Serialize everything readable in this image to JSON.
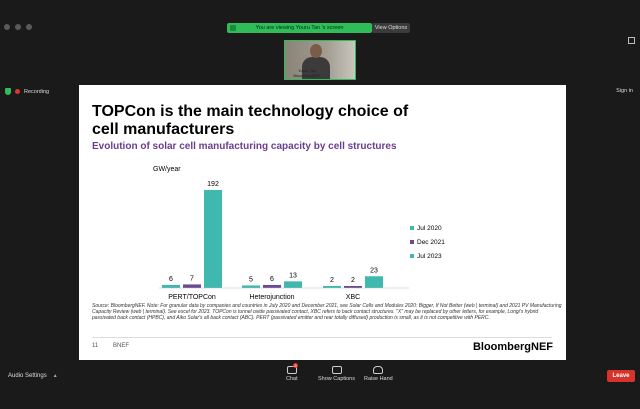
{
  "zoom": {
    "share_banner": "You are viewing Youru Tan  's screen",
    "view_options": "View Options",
    "recording": "Recording",
    "signin": "Sign in",
    "participant_name_line1": "Youru Tan",
    "participant_name_line2": "BloombergNEF"
  },
  "slide": {
    "title": "TOPCon is the main technology choice of cell manufacturers",
    "subtitle": "Evolution of solar cell manufacturing capacity by cell structures",
    "source": "Source: BloombergNEF. Note: For granular data by companies and countries in July 2020 and December 2021, see Solar Cells and Modules 2020: Bigger, If Not Better (web | terminal) and 2021 PV Manufacturing Capacity Review (web | terminal). See excel for 2023. TOPCon is tunnel oxide passivated contact, XBC refers to back contact structures. \"X\" may be replaced by other letters, for example, Longi's hybrid passivated back contact (HPBC), and Aiko Solar's all back contact (ABC). PERT (passivated emitter and rear totally diffused) production is small, as it is not competitive with PERC.",
    "page_number": "11",
    "footer_brand": "BNEF",
    "logo": "BloombergNEF"
  },
  "chart_data": {
    "type": "bar",
    "ylabel": "GW/year",
    "categories": [
      "PERT/TOPCon",
      "Heterojunction",
      "XBC"
    ],
    "series": [
      {
        "name": "Jul 2020",
        "color": "#3fb8ad",
        "values": [
          6,
          5,
          2
        ]
      },
      {
        "name": "Dec 2021",
        "color": "#6a4a94",
        "values": [
          7,
          6,
          2
        ]
      },
      {
        "name": "Jul 2023",
        "color": "#3fb8ad",
        "values": [
          192,
          13,
          23
        ]
      }
    ],
    "ylim": [
      0,
      192
    ],
    "legend_position": "right"
  },
  "toolbar": {
    "audio_settings": "Audio Settings",
    "chat": "Chat",
    "chat_badge": "8",
    "show_captions": "Show Captions",
    "raise_hand": "Raise Hand",
    "leave": "Leave"
  }
}
